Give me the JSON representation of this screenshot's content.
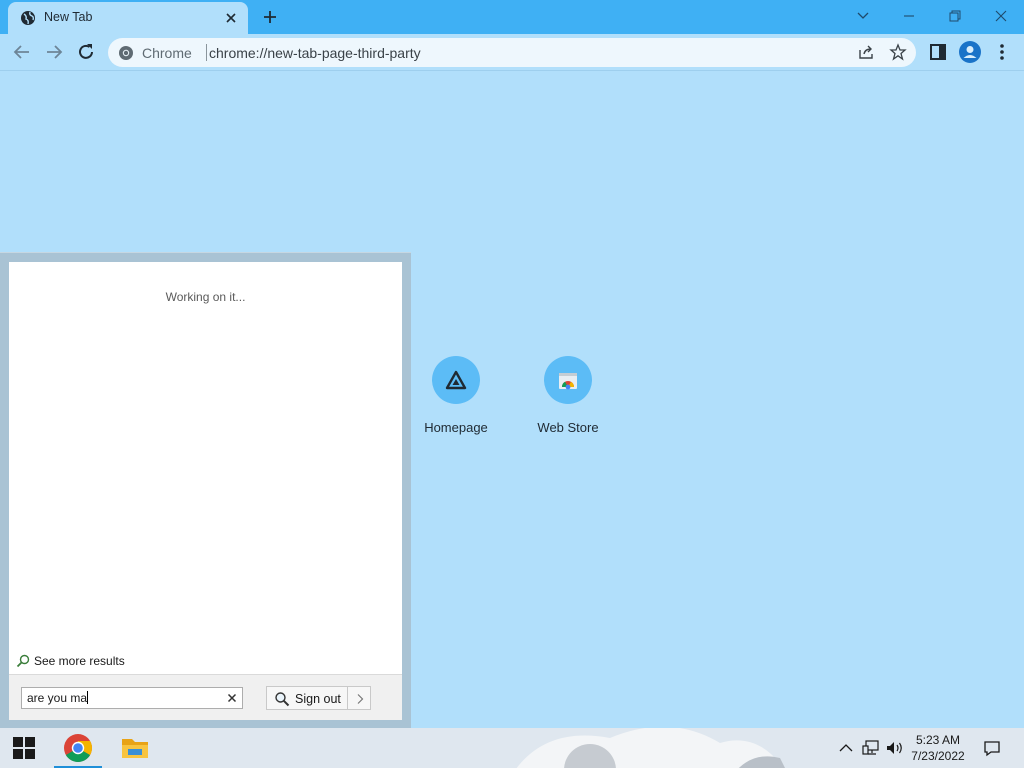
{
  "browser": {
    "tab": {
      "title": "New Tab"
    },
    "address_bar": {
      "site_label": "Chrome",
      "url": "chrome://new-tab-page-third-party"
    }
  },
  "shortcuts": [
    {
      "label": "Homepage",
      "icon": "homepage-icon"
    },
    {
      "label": "Web Store",
      "icon": "web-store-icon"
    }
  ],
  "search_panel": {
    "status": "Working on it...",
    "see_more": "See more results",
    "query": "are you ma",
    "signout_label": "Sign out"
  },
  "taskbar": {
    "apps": [
      "windows-start",
      "google-chrome",
      "file-explorer"
    ],
    "clock": {
      "time": "5:23 AM",
      "date": "7/23/2022"
    }
  },
  "colors": {
    "titlebar": "#3fb0f4",
    "page_background": "#b1dffb",
    "shortcut_circle": "#5cbcf6"
  }
}
